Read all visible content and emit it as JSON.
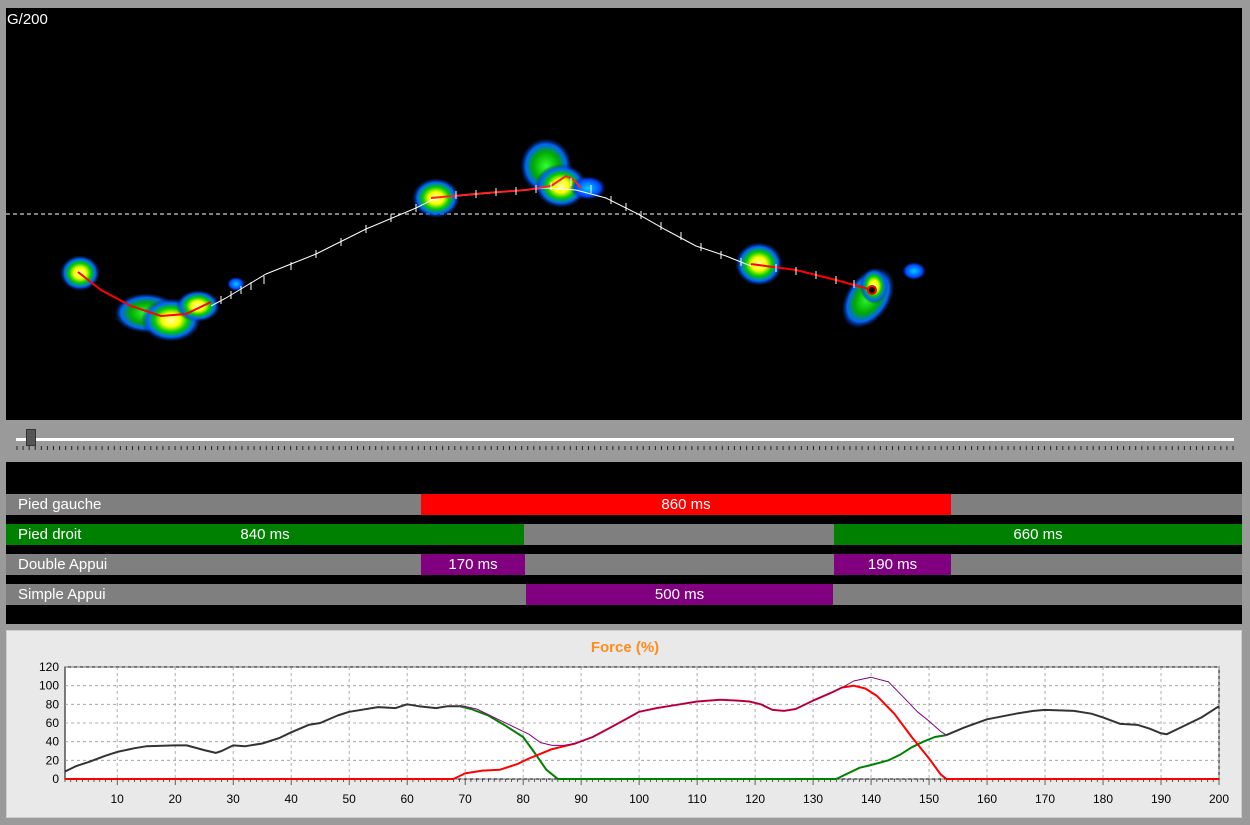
{
  "heatmap": {
    "frame_label": "G/200"
  },
  "phases": [
    {
      "label": "Pied gauche",
      "segments": [
        {
          "text": "860 ms",
          "color": "#ff0000"
        }
      ]
    },
    {
      "label": "Pied droit",
      "segments": [
        {
          "text": "840 ms",
          "color": "#008000"
        },
        {
          "text": "660 ms",
          "color": "#008000"
        }
      ]
    },
    {
      "label": "Double Appui",
      "segments": [
        {
          "text": "170 ms",
          "color": "#800080"
        },
        {
          "text": "190 ms",
          "color": "#800080"
        }
      ]
    },
    {
      "label": "Simple Appui",
      "segments": [
        {
          "text": "500 ms",
          "color": "#800080"
        }
      ]
    }
  ],
  "colors": {
    "red": "#ff0000",
    "green": "#008000",
    "purple": "#800080",
    "dark": "#333333",
    "title_orange": "#ff8c1a"
  },
  "chart_data": {
    "type": "line",
    "title": "Force (%)",
    "xlabel": "",
    "ylabel": "",
    "xlim": [
      1,
      200
    ],
    "ylim": [
      0,
      120
    ],
    "x_ticks": [
      10,
      20,
      30,
      40,
      50,
      60,
      70,
      80,
      90,
      100,
      110,
      120,
      130,
      140,
      150,
      160,
      170,
      180,
      190,
      200
    ],
    "y_ticks": [
      0,
      20,
      40,
      60,
      80,
      100,
      120
    ],
    "grid": true,
    "series": [
      {
        "color": "#333333",
        "points": [
          [
            1,
            8
          ],
          [
            3,
            14
          ],
          [
            5,
            18
          ],
          [
            8,
            25
          ],
          [
            10,
            29
          ],
          [
            13,
            33
          ],
          [
            15,
            35
          ],
          [
            20,
            36
          ],
          [
            22,
            36
          ],
          [
            25,
            31
          ],
          [
            27,
            28
          ],
          [
            28,
            30
          ],
          [
            30,
            36
          ],
          [
            32,
            35
          ],
          [
            35,
            38
          ],
          [
            38,
            44
          ],
          [
            40,
            50
          ],
          [
            43,
            58
          ],
          [
            45,
            60
          ],
          [
            48,
            68
          ],
          [
            50,
            72
          ],
          [
            55,
            77
          ],
          [
            58,
            76
          ],
          [
            60,
            80
          ],
          [
            62,
            78
          ],
          [
            65,
            76
          ],
          [
            67,
            78
          ],
          [
            69,
            78
          ]
        ]
      },
      {
        "color": "#008000",
        "points": [
          [
            69,
            78
          ],
          [
            71,
            75
          ],
          [
            74,
            68
          ],
          [
            77,
            57
          ],
          [
            80,
            45
          ],
          [
            82,
            28
          ],
          [
            84,
            10
          ],
          [
            86,
            0
          ],
          [
            134,
            0
          ],
          [
            136,
            6
          ],
          [
            138,
            12
          ],
          [
            140,
            15
          ],
          [
            143,
            20
          ],
          [
            145,
            26
          ],
          [
            147,
            34
          ],
          [
            149,
            40
          ],
          [
            151,
            45
          ],
          [
            153,
            47
          ]
        ]
      },
      {
        "color": "#333333",
        "points": [
          [
            153,
            47
          ],
          [
            156,
            55
          ],
          [
            160,
            64
          ],
          [
            165,
            70
          ],
          [
            168,
            73
          ],
          [
            170,
            74
          ],
          [
            175,
            73
          ],
          [
            178,
            70
          ],
          [
            180,
            66
          ],
          [
            183,
            59
          ],
          [
            186,
            58
          ],
          [
            188,
            54
          ],
          [
            190,
            49
          ],
          [
            191,
            48
          ],
          [
            193,
            54
          ],
          [
            195,
            60
          ],
          [
            197,
            66
          ],
          [
            200,
            78
          ]
        ]
      },
      {
        "color": "#ff0000",
        "points": [
          [
            1,
            0
          ],
          [
            68,
            0
          ],
          [
            70,
            6
          ],
          [
            73,
            9
          ],
          [
            76,
            10
          ],
          [
            79,
            16
          ],
          [
            81,
            22
          ],
          [
            83,
            27
          ],
          [
            85,
            32
          ],
          [
            87,
            35
          ],
          [
            89,
            38
          ],
          [
            92,
            45
          ],
          [
            95,
            55
          ],
          [
            98,
            65
          ],
          [
            100,
            72
          ],
          [
            103,
            76
          ],
          [
            106,
            79
          ],
          [
            110,
            83
          ],
          [
            114,
            85
          ],
          [
            117,
            84
          ],
          [
            119,
            83
          ],
          [
            121,
            80
          ],
          [
            123,
            74
          ],
          [
            125,
            73
          ],
          [
            127,
            75
          ],
          [
            130,
            84
          ],
          [
            133,
            92
          ],
          [
            135,
            98
          ],
          [
            137,
            100
          ],
          [
            139,
            97
          ],
          [
            141,
            89
          ],
          [
            144,
            70
          ],
          [
            147,
            45
          ],
          [
            150,
            22
          ],
          [
            152,
            5
          ],
          [
            153,
            0
          ],
          [
            200,
            0
          ]
        ]
      },
      {
        "color": "#800080",
        "points": [
          [
            69,
            79
          ],
          [
            72,
            75
          ],
          [
            75,
            66
          ],
          [
            78,
            57
          ],
          [
            81,
            48
          ],
          [
            83,
            39
          ],
          [
            85,
            36
          ],
          [
            87,
            36
          ],
          [
            89,
            38
          ],
          [
            92,
            45
          ],
          [
            95,
            55
          ],
          [
            98,
            65
          ],
          [
            100,
            72
          ],
          [
            103,
            76
          ],
          [
            106,
            79
          ],
          [
            110,
            83
          ],
          [
            114,
            85
          ],
          [
            117,
            84
          ],
          [
            119,
            83
          ],
          [
            121,
            80
          ],
          [
            123,
            74
          ],
          [
            125,
            73
          ],
          [
            127,
            75
          ],
          [
            130,
            84
          ],
          [
            133,
            92
          ],
          [
            135,
            98
          ],
          [
            137,
            105
          ],
          [
            140,
            109
          ],
          [
            143,
            104
          ],
          [
            146,
            85
          ],
          [
            148,
            72
          ],
          [
            150,
            62
          ],
          [
            152,
            51
          ],
          [
            153,
            47
          ]
        ]
      }
    ]
  }
}
